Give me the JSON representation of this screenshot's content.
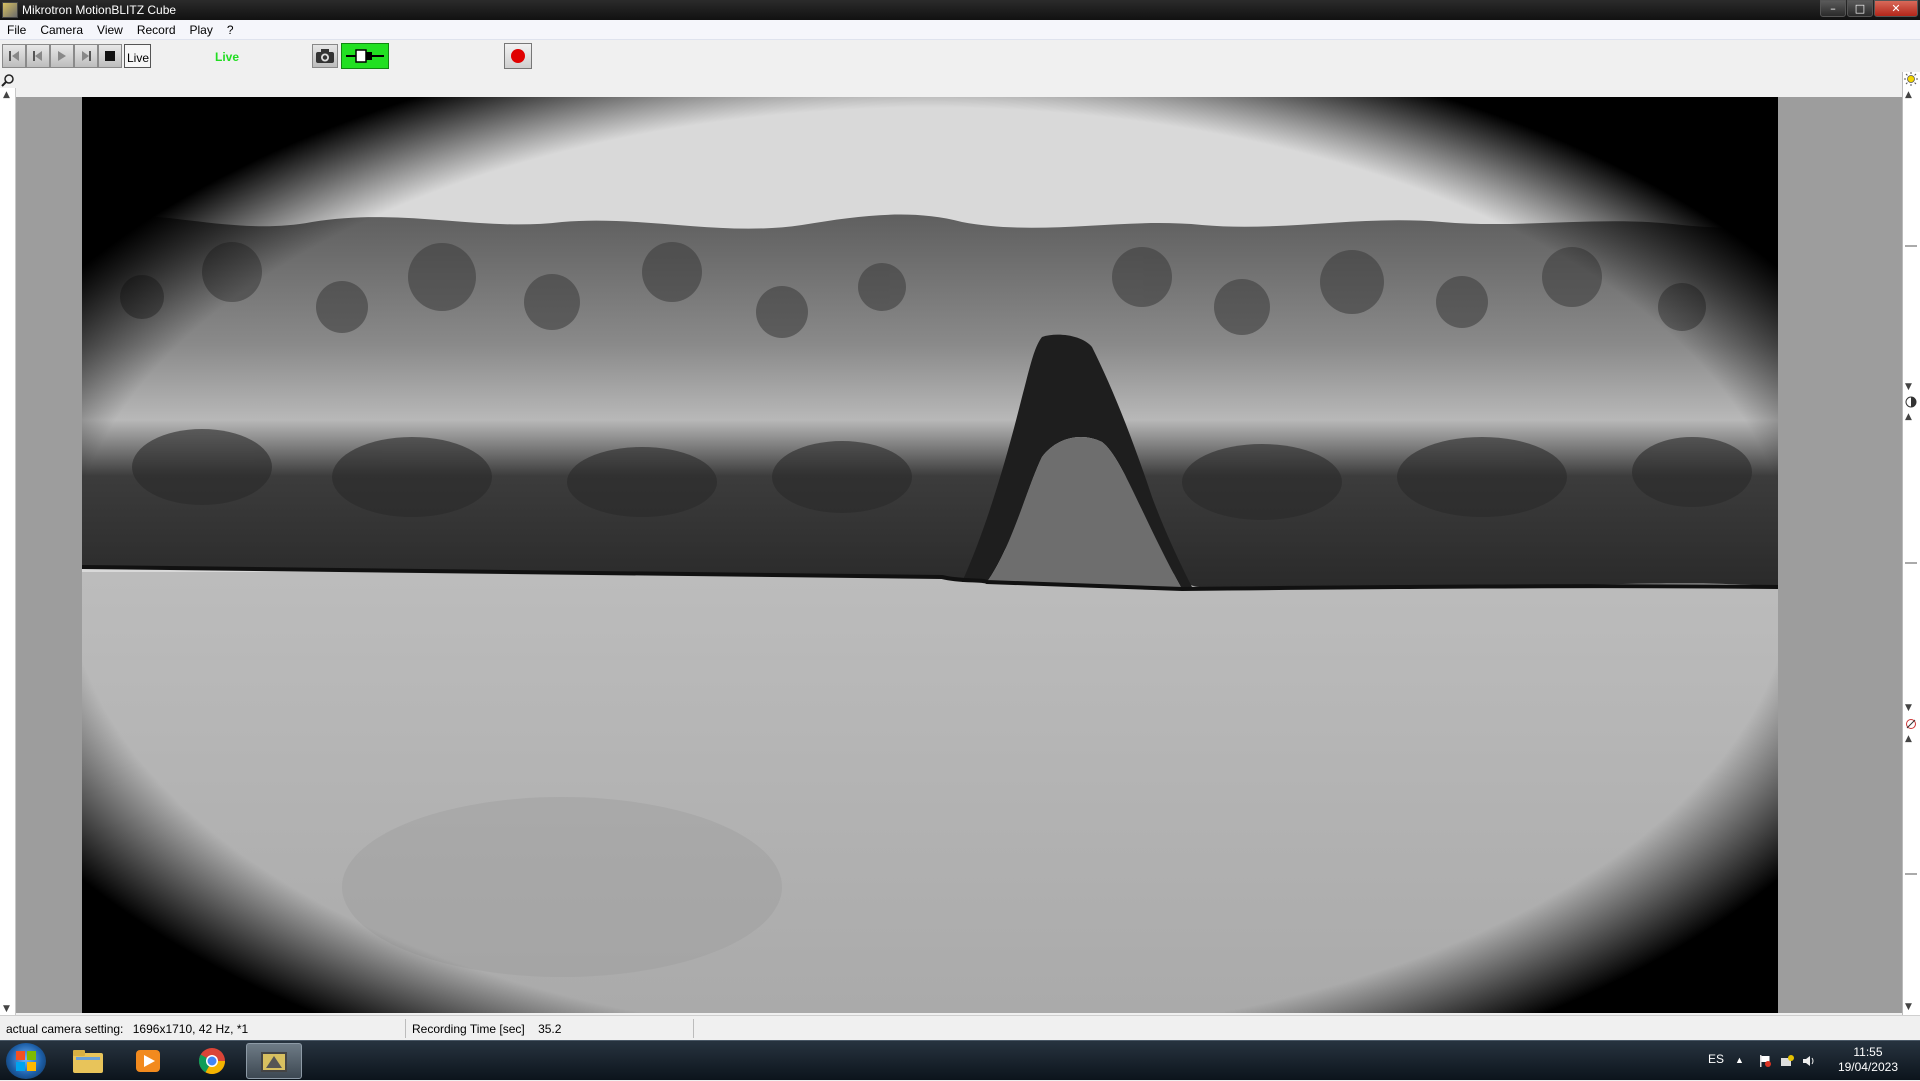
{
  "window": {
    "title": "Mikrotron MotionBLITZ Cube",
    "controls": {
      "minimize": "–",
      "maximize": "□",
      "close": "✕"
    }
  },
  "menu": {
    "items": [
      "File",
      "Camera",
      "View",
      "Record",
      "Play",
      "?"
    ]
  },
  "toolbar": {
    "live_button": "Live",
    "live_status": "Live",
    "buttons": [
      "skip-start-icon",
      "step-back-icon",
      "play-icon",
      "step-forward-icon",
      "stop-icon",
      "camera-icon",
      "connection-icon",
      "record-icon"
    ],
    "status_color": "#22dd22",
    "record_color": "#e00000"
  },
  "status": {
    "camera_label": "actual camera setting:",
    "camera_value": "1696x1710, 42 Hz, *1",
    "recording_label": "Recording Time [sec]",
    "recording_value": "35.2"
  },
  "taskbar": {
    "apps": [
      "start-button",
      "file-explorer-icon",
      "media-player-icon",
      "chrome-icon",
      "motionblitz-icon"
    ],
    "language": "ES",
    "time": "11:55",
    "date": "19/04/2023"
  }
}
